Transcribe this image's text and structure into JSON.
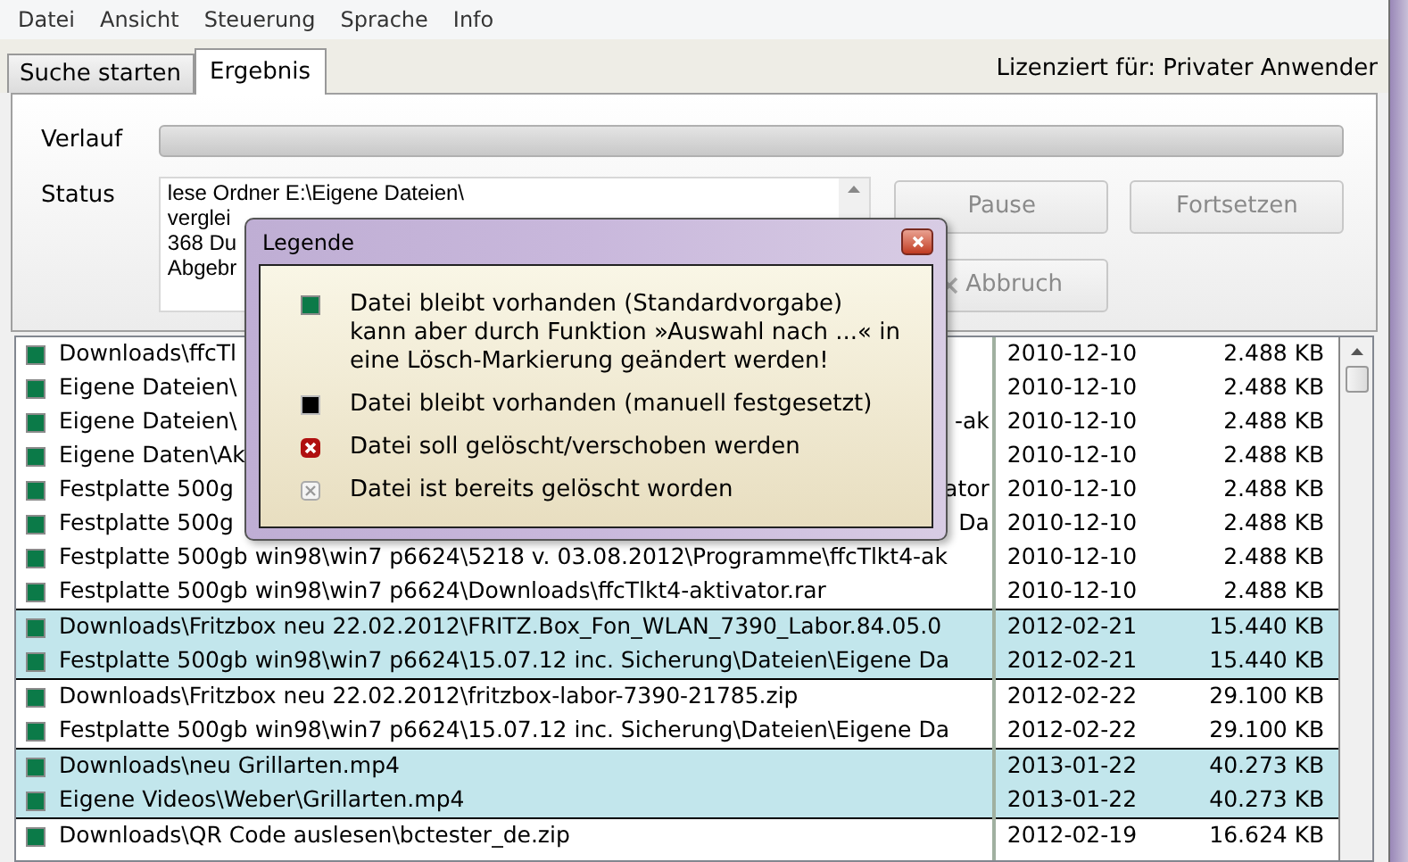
{
  "menu": [
    "Datei",
    "Ansicht",
    "Steuerung",
    "Sprache",
    "Info"
  ],
  "tabs": [
    {
      "label": "Suche starten",
      "selected": false
    },
    {
      "label": "Ergebnis",
      "selected": true
    }
  ],
  "license": "Lizenziert für: Privater Anwender",
  "progress": {
    "label": "Verlauf",
    "level": 0
  },
  "status": {
    "label": "Status",
    "lines": [
      "lese Ordner E:\\Eigene Dateien\\",
      "verglei",
      "368 Du",
      "Abgebr"
    ]
  },
  "buttons": [
    {
      "label": "Pause",
      "disabled": true
    },
    {
      "label": "Fortsetzen",
      "disabled": true
    },
    {
      "label": "Abbruch",
      "disabled": true
    }
  ],
  "groups": [
    {
      "selected": false,
      "rows": [
        {
          "kind": "keep",
          "path": "Downloads\\ffcTl",
          "date": "2010-12-10",
          "size": "2.488 KB"
        },
        {
          "kind": "keep",
          "path": "Eigene Dateien\\",
          "date": "2010-12-10",
          "size": "2.488 KB"
        },
        {
          "kind": "keep",
          "path": "Eigene Dateien\\",
          "path_end": "-ak",
          "date": "2010-12-10",
          "size": "2.488 KB"
        },
        {
          "kind": "keep",
          "path": "Eigene Daten\\Ak",
          "date": "2010-12-10",
          "size": "2.488 KB"
        },
        {
          "kind": "keep",
          "path": "Festplatte 500g",
          "path_end": "ator",
          "date": "2010-12-10",
          "size": "2.488 KB"
        },
        {
          "kind": "keep",
          "path": "Festplatte 500g",
          "path_end": "Da",
          "date": "2010-12-10",
          "size": "2.488 KB"
        },
        {
          "kind": "keep",
          "path": "Festplatte 500gb win98\\win7 p6624\\5218 v. 03.08.2012\\Programme\\ffcTlkt4-ak",
          "date": "2010-12-10",
          "size": "2.488 KB"
        },
        {
          "kind": "keep",
          "path": "Festplatte 500gb win98\\win7 p6624\\Downloads\\ffcTlkt4-aktivator.rar",
          "date": "2010-12-10",
          "size": "2.488 KB"
        }
      ]
    },
    {
      "selected": true,
      "rows": [
        {
          "kind": "keep",
          "path": "Downloads\\Fritzbox neu 22.02.2012\\FRITZ.Box_Fon_WLAN_7390_Labor.84.05.0",
          "date": "2012-02-21",
          "size": "15.440 KB"
        },
        {
          "kind": "keep",
          "path": "Festplatte 500gb win98\\win7 p6624\\15.07.12 inc. Sicherung\\Dateien\\Eigene Da",
          "date": "2012-02-21",
          "size": "15.440 KB"
        }
      ]
    },
    {
      "selected": false,
      "rows": [
        {
          "kind": "keep",
          "path": "Downloads\\Fritzbox neu 22.02.2012\\fritzbox-labor-7390-21785.zip",
          "date": "2012-02-22",
          "size": "29.100 KB"
        },
        {
          "kind": "keep",
          "path": "Festplatte 500gb win98\\win7 p6624\\15.07.12 inc. Sicherung\\Dateien\\Eigene Da",
          "date": "2012-02-22",
          "size": "29.100 KB"
        }
      ]
    },
    {
      "selected": true,
      "rows": [
        {
          "kind": "keep",
          "path": "Downloads\\neu Grillarten.mp4",
          "date": "2013-01-22",
          "size": "40.273 KB"
        },
        {
          "kind": "keep",
          "path": "Eigene Videos\\Weber\\Grillarten.mp4",
          "date": "2013-01-22",
          "size": "40.273 KB"
        }
      ]
    },
    {
      "selected": false,
      "rows": [
        {
          "kind": "keep",
          "path": "Downloads\\QR Code auslesen\\bctester_de.zip",
          "date": "2012-02-19",
          "size": "16.624 KB"
        }
      ]
    }
  ],
  "legend": {
    "title": "Legende",
    "items": [
      {
        "kind": "keep",
        "text": "Datei bleibt vorhanden (Standardvorgabe)\nkann aber durch Funktion »Auswahl nach ...« in\neine Lösch-Markierung geändert werden!"
      },
      {
        "kind": "manual",
        "text": "Datei bleibt vorhanden (manuell festgesetzt)"
      },
      {
        "kind": "delete",
        "text": "Datei soll gelöscht/verschoben werden"
      },
      {
        "kind": "deleted",
        "text": "Datei ist bereits gelöscht worden"
      }
    ]
  }
}
